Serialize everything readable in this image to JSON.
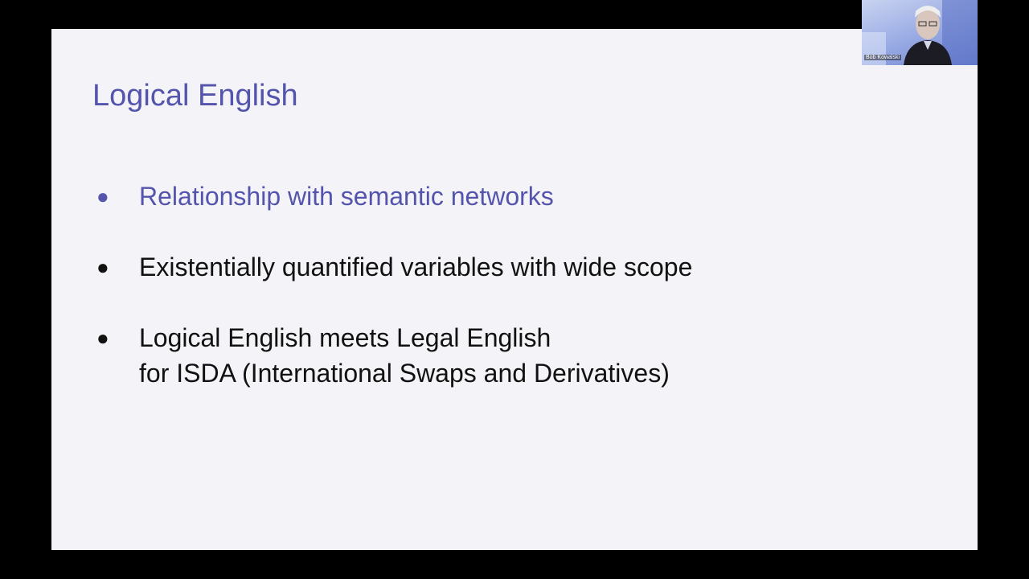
{
  "slide": {
    "title": "Logical English",
    "bullets": [
      {
        "lines": [
          "Relationship with semantic networks"
        ],
        "accent": true
      },
      {
        "lines": [
          "Existentially quantified variables with wide scope"
        ],
        "accent": false
      },
      {
        "lines": [
          "Logical English meets Legal English",
          "for ISDA (International Swaps and Derivatives)"
        ],
        "accent": false
      }
    ],
    "bullet_glyph": "●"
  },
  "webcam": {
    "speaker_name": "Bob Kowalski"
  },
  "colors": {
    "title": "#5454ad",
    "accent_bullet": "#5454ad",
    "body_text": "#111111",
    "slide_background": "#f4f4f8",
    "frame_background": "#000000"
  }
}
